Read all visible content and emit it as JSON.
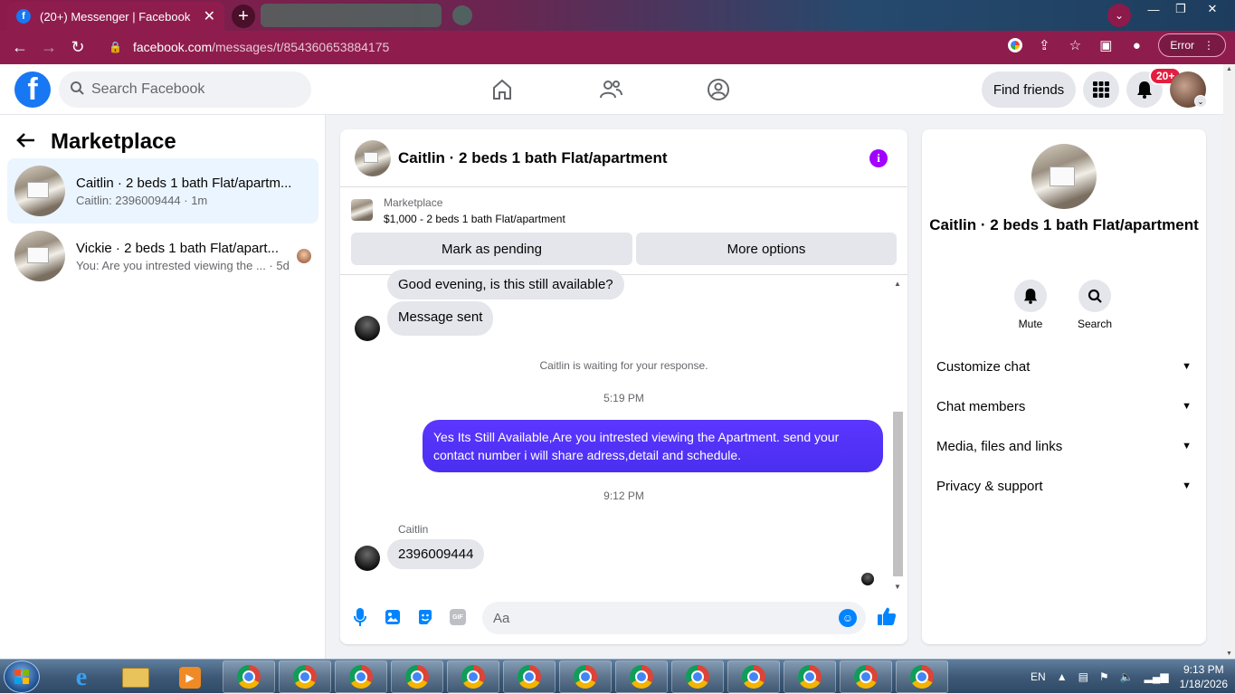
{
  "browser": {
    "tab_title": "(20+) Messenger | Facebook",
    "tab_close": "✕",
    "new_tab": "+",
    "url_host": "facebook.com",
    "url_path": "/messages/t/854360653884175",
    "error_label": "Error"
  },
  "fb": {
    "search_placeholder": "Search Facebook",
    "find_friends": "Find friends",
    "notif_badge": "20+"
  },
  "sidebar": {
    "title": "Marketplace",
    "conversations": [
      {
        "name": "Caitlin · 2 beds 1 bath Flat/apartm...",
        "snippet": "Caitlin: 2396009444 · 1m"
      },
      {
        "name": "Vickie · 2 beds 1 bath Flat/apart...",
        "snippet": "You: Are you intrested viewing the ... · 5d"
      }
    ]
  },
  "chat": {
    "title": "Caitlin · 2 beds 1 bath Flat/apartment",
    "listing_label": "Marketplace",
    "listing_title": "$1,000 - 2 beds 1 bath Flat/apartment",
    "mark_pending": "Mark as pending",
    "more_options": "More options",
    "messages": {
      "m1": "Good evening, is this still available?",
      "m2": "Message sent",
      "waiting": "Caitlin is waiting for your response.",
      "time1": "5:19 PM",
      "out1": "Yes Its Still Available,Are you intrested viewing the Apartment. send your contact number i will share adress,detail and schedule.",
      "time2": "9:12 PM",
      "sender": "Caitlin",
      "m3": "2396009444"
    },
    "composer_placeholder": "Aa",
    "gif_label": "GIF"
  },
  "details": {
    "title": "Caitlin · 2 beds 1 bath Flat/apartment",
    "mute": "Mute",
    "search": "Search",
    "rows": [
      "Customize chat",
      "Chat members",
      "Media, files and links",
      "Privacy & support"
    ]
  },
  "taskbar": {
    "lang": "EN",
    "time": "9:13 PM",
    "date": "1/18/2026"
  }
}
